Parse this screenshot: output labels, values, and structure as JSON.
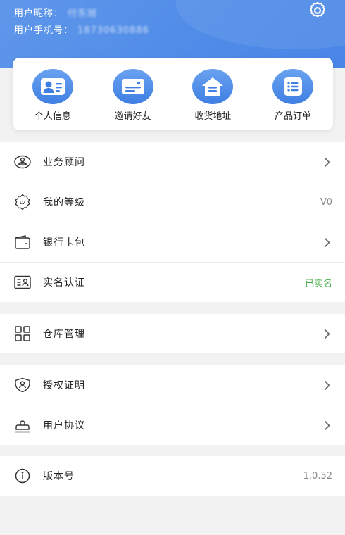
{
  "header": {
    "nickname_label": "用户昵称：",
    "nickname_value": "付东旭",
    "phone_label": "用户手机号：",
    "phone_value": "18730630886"
  },
  "quick_actions": [
    {
      "label": "个人信息",
      "icon": "id-card-icon"
    },
    {
      "label": "邀请好友",
      "icon": "card-icon"
    },
    {
      "label": "收货地址",
      "icon": "house-icon"
    },
    {
      "label": "产品订单",
      "icon": "list-icon"
    }
  ],
  "menu": {
    "advisor": "业务顾问",
    "level": "我的等级",
    "level_value": "V0",
    "bank": "银行卡包",
    "realname": "实名认证",
    "realname_value": "已实名",
    "warehouse": "仓库管理",
    "authorization": "授权证明",
    "agreement": "用户协议",
    "version": "版本号",
    "version_value": "1.0.52"
  },
  "colors": {
    "brand": "#4f8be8",
    "verified": "#49b04a"
  }
}
